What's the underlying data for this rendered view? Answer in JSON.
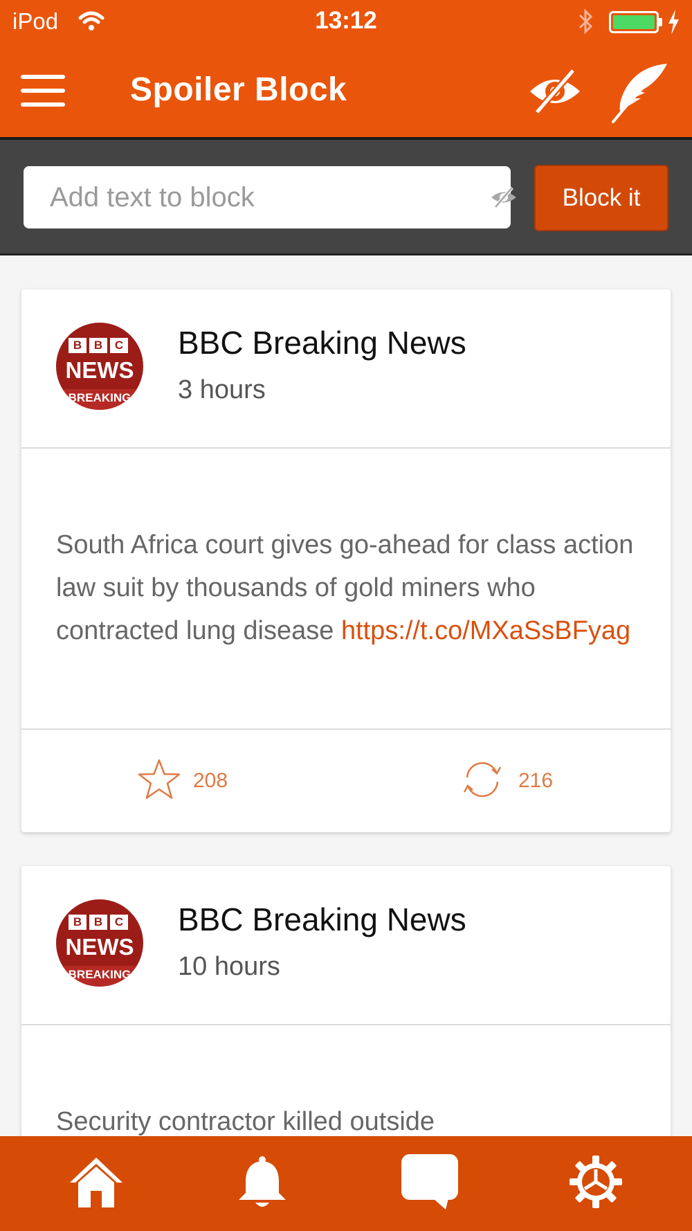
{
  "status_bar": {
    "carrier": "iPod",
    "time": "13:12",
    "battery_level": 1.0,
    "icons": [
      "wifi-icon",
      "bluetooth-icon",
      "battery-icon",
      "charging-icon"
    ]
  },
  "header": {
    "title": "Spoiler Block",
    "icons": [
      "menu-icon",
      "eye-slash-icon",
      "feather-icon"
    ]
  },
  "block_bar": {
    "input_placeholder": "Add text to block",
    "input_value": "",
    "button_label": "Block it"
  },
  "colors": {
    "primary": "#e9550a",
    "tabbar": "#d64b05",
    "button": "#d34a08",
    "link": "#d9500e",
    "blockbar": "#444444"
  },
  "feed": [
    {
      "author": "BBC Breaking News",
      "avatar_text": {
        "top": [
          "B",
          "B",
          "C"
        ],
        "middle": "NEWS",
        "bottom": "BREAKING"
      },
      "time": "3 hours",
      "text": "South Africa court gives go-ahead for class action law suit by thousands of gold miners who contracted lung disease",
      "link": "https://t.co/MXaSsBFyag",
      "favorites": "208",
      "retweets": "216"
    },
    {
      "author": "BBC Breaking News",
      "avatar_text": {
        "top": [
          "B",
          "B",
          "C"
        ],
        "middle": "NEWS",
        "bottom": "BREAKING"
      },
      "time": "10 hours",
      "text": "Security contractor killed outside"
    }
  ],
  "tabbar": {
    "icons": [
      "home-icon",
      "bell-icon",
      "chat-icon",
      "settings-gear-icon"
    ]
  }
}
